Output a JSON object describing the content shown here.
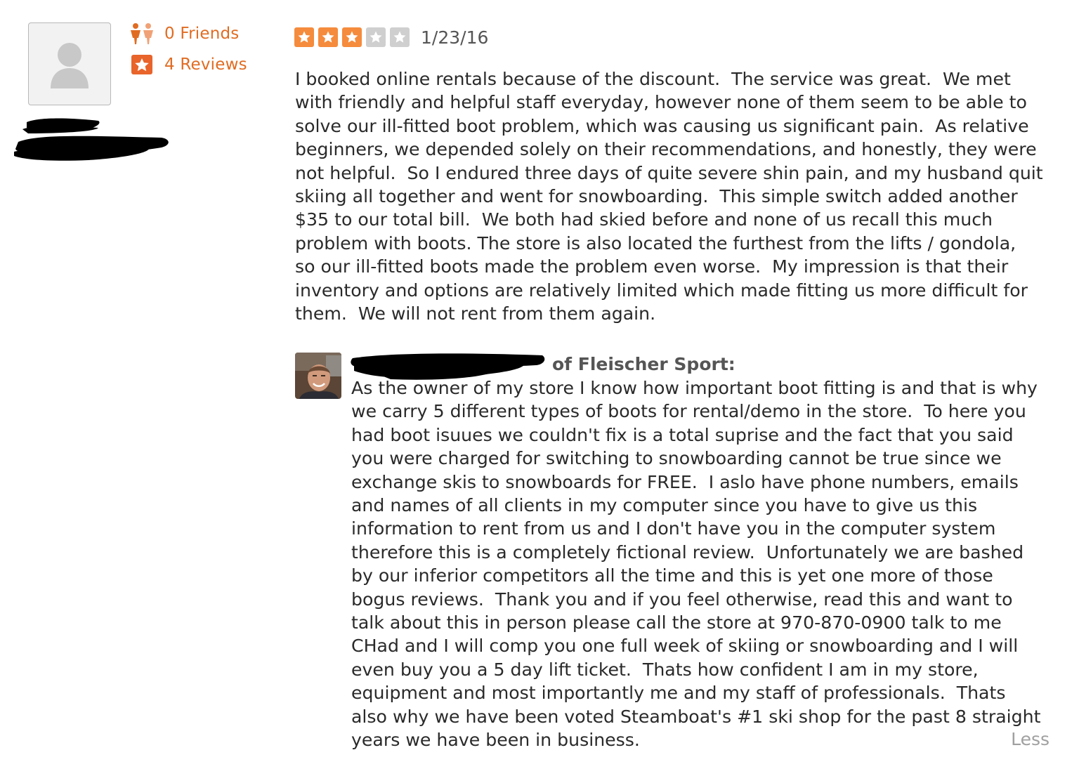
{
  "reviewer": {
    "friends_label": "0 Friends",
    "reviews_label": "4 Reviews",
    "avatar_icon": "default-user-avatar-icon",
    "friends_icon": "friends-icon",
    "reviews_icon": "star-badge-icon"
  },
  "review": {
    "rating": 3,
    "max_rating": 5,
    "date": "1/23/16",
    "text": "I booked online rentals because of the discount.  The service was great.  We met\nwith friendly and helpful staff everyday, however none of them seem to be able to\nsolve our ill-fitted boot problem, which was causing us significant pain.  As relative\nbeginners, we depended solely on their recommendations, and honestly, they were\nnot helpful.  So I endured three days of quite severe shin pain, and my husband quit\nskiing all together and went for snowboarding.  This simple switch added another\n$35 to our total bill.  We both had skied before and none of us recall this much\nproblem with boots. The store is also located the furthest from the lifts / gondola,\nso our ill-fitted boots made the problem even worse.  My impression is that their\ninventory and options are relatively limited which made fitting us more difficult for\nthem.  We will not rent from them again."
  },
  "owner_reply": {
    "header": "of Fleischer Sport:",
    "text": "As the owner of my store I know how important boot fitting is and that is why\nwe carry 5 different types of boots for rental/demo in the store.  To here you\nhad boot isuues we couldn't fix is a total suprise and the fact that you said\nyou were charged for switching to snowboarding cannot be true since we\nexchange skis to snowboards for FREE.  I aslo have phone numbers, emails\nand names of all clients in my computer since you have to give us this\ninformation to rent from us and I don't have you in the computer system\ntherefore this is a completely fictional review.  Unfortunately we are bashed\nby our inferior competitors all the time and this is yet one more of those\nbogus reviews.  Thank you and if you feel otherwise, read this and want to\ntalk about this in person please call the store at 970-870-0900 talk to me\nCHad and I will comp you one full week of skiing or snowboarding and I will\neven buy you a 5 day lift ticket.  Thats how confident I am in my store,\nequipment and most importantly me and my staff of professionals.  Thats\nalso why we have been voted Steamboat's #1 ski shop for the past 8 straight\nyears we have been in business.",
    "less_label": "Less"
  },
  "colors": {
    "accent": "#e06c22",
    "star_on": "#f58b3c",
    "star_off": "#cfcfcf"
  }
}
